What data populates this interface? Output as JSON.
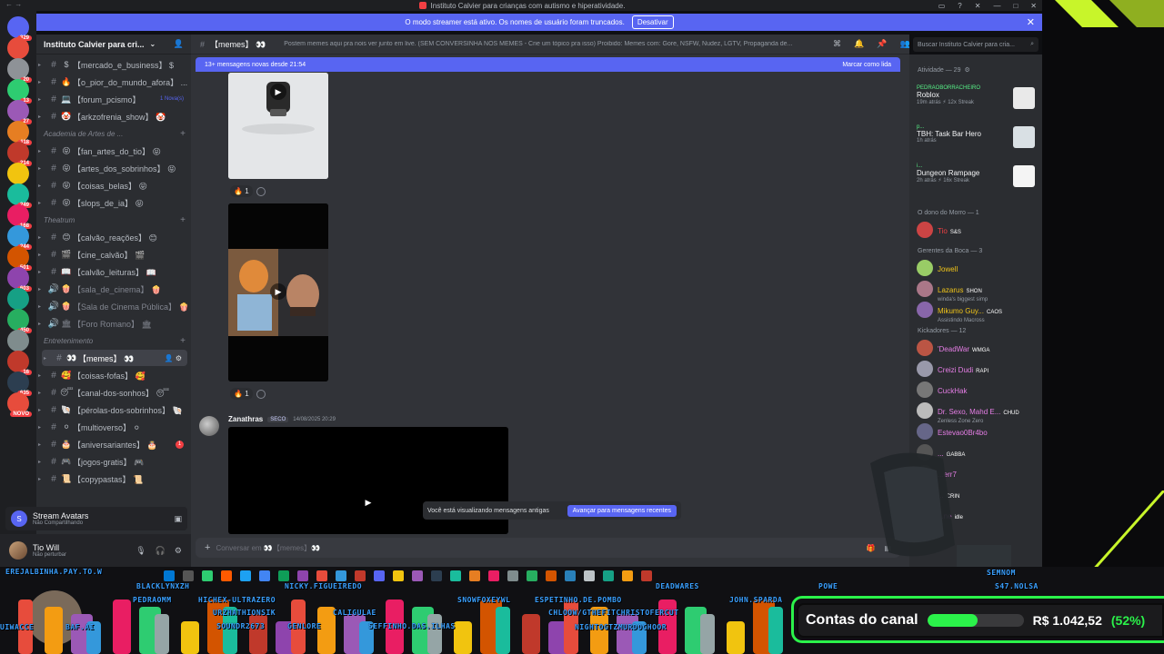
{
  "window": {
    "title": "Instituto Calvier para crianças com autismo e hiperatividade."
  },
  "banner": {
    "text": "O modo streamer está ativo. Os nomes de usuário foram truncados.",
    "button": "Desativar"
  },
  "server": {
    "name": "Instituto Calvier para cri...",
    "rail_counts": [
      "329",
      "",
      "20",
      "13",
      "27",
      "118",
      "214",
      "",
      "249",
      "168",
      "244",
      "501",
      "603",
      "",
      "450",
      "",
      "16",
      "635",
      "NOVO"
    ]
  },
  "channels": [
    {
      "emoji": "$",
      "label": "【mercado_e_business】 $",
      "type": "text"
    },
    {
      "emoji": "🔥",
      "label": "【o_pior_do_mundo_afora】 ...",
      "type": "text"
    },
    {
      "emoji": "💻",
      "label": "【forum_pcismo】",
      "type": "text",
      "badge": "1 Nova(s)"
    },
    {
      "emoji": "🤡",
      "label": "【arkzofrenia_show】 🤡",
      "type": "text"
    },
    {
      "category": "Academia de Artes de ..."
    },
    {
      "emoji": "😝",
      "label": "【fan_artes_do_tio】 😝",
      "type": "text"
    },
    {
      "emoji": "😝",
      "label": "【artes_dos_sobrinhos】 😝",
      "type": "text"
    },
    {
      "emoji": "😝",
      "label": "【coisas_belas】 😝",
      "type": "text"
    },
    {
      "emoji": "😝",
      "label": "【slops_de_ia】 😝",
      "type": "text"
    },
    {
      "category": "Theatrum"
    },
    {
      "emoji": "😊",
      "label": "【calvão_reações】 😊",
      "type": "text"
    },
    {
      "emoji": "🎬",
      "label": "【cine_calvão】 🎬",
      "type": "text"
    },
    {
      "emoji": "📖",
      "label": "【calvão_leituras】 📖",
      "type": "text"
    },
    {
      "emoji": "🍿",
      "label": "【sala_de_cinema】 🍿",
      "type": "voice"
    },
    {
      "emoji": "🍿",
      "label": "【Sala de Cinema Pública】 🍿",
      "type": "voice"
    },
    {
      "emoji": "🏛",
      "label": "【Foro Romano】 🏛",
      "type": "voice"
    },
    {
      "category": "Entretenimento"
    },
    {
      "emoji": "👀",
      "label": "【memes】 👀",
      "type": "text",
      "active": true
    },
    {
      "emoji": "🥰",
      "label": "【coisas-fofas】 🥰",
      "type": "text"
    },
    {
      "emoji": "😴",
      "label": "【canal-dos-sonhos】 😴",
      "type": "text"
    },
    {
      "emoji": "🐚",
      "label": "【pérolas-dos-sobrinhos】 🐚",
      "type": "text"
    },
    {
      "emoji": "⚪",
      "label": "【multioverso】 ⚪",
      "type": "text"
    },
    {
      "emoji": "🎂",
      "label": "【aniversariantes】 🎂",
      "type": "text",
      "red": "1"
    },
    {
      "emoji": "🎮",
      "label": "【jogos-gratis】 🎮",
      "type": "text"
    },
    {
      "emoji": "📜",
      "label": "【copypastas】 📜",
      "type": "text"
    }
  ],
  "stream_panel": {
    "title": "Stream Avatars",
    "subtitle": "Não Compartilhando"
  },
  "user_panel": {
    "name": "Tio Will",
    "status": "Não perturbar"
  },
  "chat_header": {
    "channel": "【memes】 👀",
    "topic": "Postem memes aqui pra nois ver junto em live. (SEM CONVERSINHA NOS MEMES - Crie um tópico pra isso) Proibido: Memes com: Gore, NSFW, Nudez, LGTV, Propaganda de...",
    "search_placeholder": "Buscar Instituto Calvier para cria..."
  },
  "new_messages": {
    "text": "13+ mensagens novas desde 21:54",
    "mark": "Marcar como lida"
  },
  "reactions": [
    {
      "emoji": "🔥",
      "count": "1"
    },
    {
      "emoji": "🔥",
      "count": "1"
    }
  ],
  "message": {
    "author": "Zanathras",
    "tag": "SECO",
    "timestamp": "14/08/2025 20:29"
  },
  "old_messages": {
    "text": "Você está visualizando mensagens antigas",
    "button": "Avançar para mensagens recentes"
  },
  "composer": {
    "placeholder": "Conversar em 👀【memes】👀"
  },
  "members": {
    "activity_header": "Atividade — 29",
    "activities": [
      {
        "name": "PEDRAOBORRACHEIRO",
        "game": "Roblox",
        "status": "19m atrás  ⚡ 12x Streak"
      },
      {
        "name": "p...",
        "game": "TBH: Task Bar Hero",
        "status": "1h atrás"
      },
      {
        "name": "i...",
        "game": "Dungeon Rampage",
        "status": "2h atrás  ⚡ 16x Streak"
      }
    ],
    "groups": [
      {
        "title": "O dono do Morro — 1",
        "items": [
          {
            "name": "Tio",
            "tag": "S&S",
            "color": "#f23f43"
          }
        ]
      },
      {
        "title": "Gerentes da Boca — 3",
        "items": [
          {
            "name": "Jowell",
            "color": "#f0c419"
          },
          {
            "name": "Lazarus",
            "tag": "SHON",
            "sub": "winda's biggest simp",
            "color": "#f0c419"
          },
          {
            "name": "Mikumo Guy...",
            "tag": "CAOS",
            "sub": "Assistindo Macross",
            "color": "#f0c419"
          }
        ]
      },
      {
        "title": "Kickadores — 12",
        "items": [
          {
            "name": "'DeadWar",
            "tag": "WMGA",
            "color": "#e67ee6"
          },
          {
            "name": "Creizi Dudi",
            "tag": "RAPI",
            "color": "#e67ee6"
          },
          {
            "name": "CuckHak",
            "color": "#e67ee6"
          },
          {
            "name": "Dr. Sexo, Mahd E...",
            "tag": "CHUD",
            "sub": "Zenless Zone Zero",
            "color": "#e67ee6"
          },
          {
            "name": "Estevao0Br4bo",
            "color": "#e67ee6"
          },
          {
            "name": "...",
            "tag": "GABBA",
            "color": "#e67ee6"
          },
          {
            "name": "...err7",
            "color": "#e67ee6"
          },
          {
            "name": "...",
            "tag": "CRIN",
            "color": "#e67ee6"
          },
          {
            "name": "...ne",
            "tag": "idle",
            "color": "#e67ee6"
          }
        ]
      }
    ]
  },
  "overlay": {
    "nicknames": [
      "EREJALBINHA.PAY.TO.W",
      "BLACKLYNXZH",
      "NICKY.FIGUEIREDO",
      "DEADWARES",
      "SEMNOM",
      "PEDRAOMM",
      "HICHEX-ULTRAZERO",
      "URZHATHIONSIK",
      "SOUNDR2673",
      "SNOWFOXEYWL",
      "ESPETINHO.DE.POMBO",
      "CHLOOW/GTHEFITCHRISTOFERCUT",
      "NIGHTOGTZMURDOCHOOR",
      "JOHN.SPARDA",
      "CALIGULAE",
      "GENLORE",
      "SEFFINHO.DAS.ILHAS",
      "UIWACCE",
      "BAF.AI",
      "POWE",
      "S47.NOLSA"
    ],
    "counter_label": "Contas do canal",
    "counter_amount": "R$ 1.042,52",
    "counter_percent": "(52%)",
    "counter_fraction": 0.52
  }
}
